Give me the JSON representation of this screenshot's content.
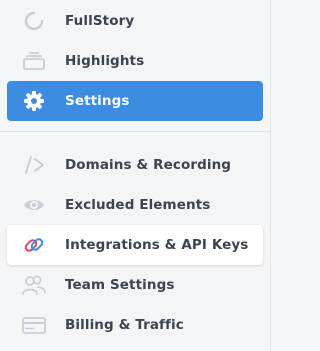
{
  "colors": {
    "background": "#f4f5f7",
    "active_background": "#3d8ce3",
    "active_text": "#ffffff",
    "text": "#3b4452",
    "icon": "#c8ced6",
    "hover_background": "#ffffff",
    "integrations_icon_accent": "#e8445a",
    "integrations_icon_primary": "#3d8ce3"
  },
  "sidebar": {
    "items": [
      {
        "label": "FullStory",
        "icon": "fullstory-logo-icon"
      },
      {
        "label": "Highlights",
        "icon": "highlights-icon"
      },
      {
        "label": "Settings",
        "icon": "gear-icon",
        "state": "active"
      }
    ],
    "settings_items": [
      {
        "label": "Domains & Recording",
        "icon": "code-icon"
      },
      {
        "label": "Excluded Elements",
        "icon": "eye-icon"
      },
      {
        "label": "Integrations & API Keys",
        "icon": "link-icon",
        "state": "hover"
      },
      {
        "label": "Team Settings",
        "icon": "team-icon"
      },
      {
        "label": "Billing & Traffic",
        "icon": "credit-card-icon"
      }
    ]
  }
}
